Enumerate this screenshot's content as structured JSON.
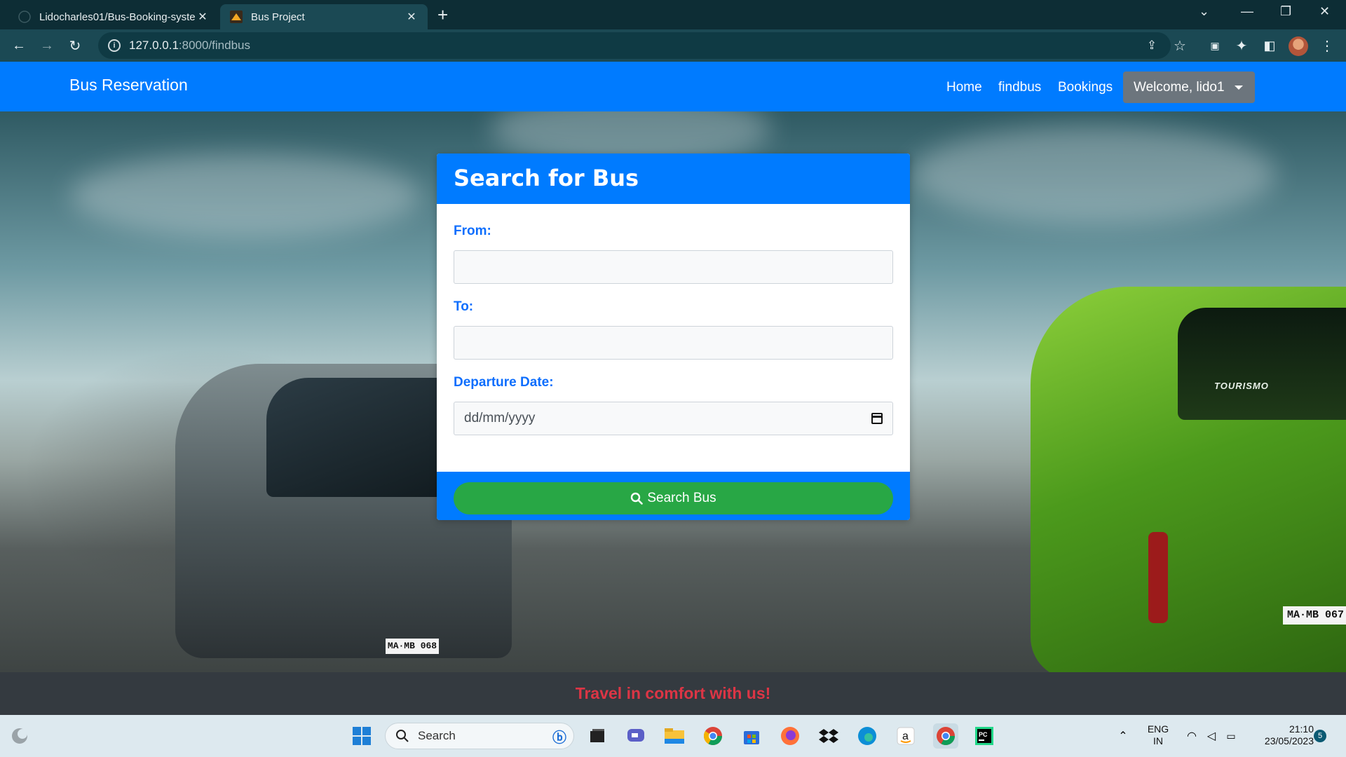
{
  "browser": {
    "tabs": [
      {
        "title": "Lidocharles01/Bus-Booking-syste",
        "active": false
      },
      {
        "title": "Bus Project",
        "active": true
      }
    ],
    "url_host": "127.0.0.1",
    "url_path": ":8000/findbus"
  },
  "navbar": {
    "brand": "Bus Reservation",
    "links": [
      "Home",
      "findbus",
      "Bookings"
    ],
    "user_menu": "Welcome, lido1"
  },
  "search_card": {
    "title": "Search for Bus",
    "from_label": "From:",
    "from_value": "",
    "to_label": "To:",
    "to_value": "",
    "date_label": "Departure Date:",
    "date_placeholder": "dd/mm/yyyy",
    "submit_label": "Search Bus"
  },
  "hero": {
    "bus_left_plate": "MA·MB 068",
    "bus_right_brand": "TOURISMO",
    "bus_right_plate": "MA·MB 067"
  },
  "footer": {
    "tagline": "Travel in comfort with us!"
  },
  "taskbar": {
    "search_placeholder": "Search",
    "lang_top": "ENG",
    "lang_bottom": "IN",
    "time": "21:10",
    "date": "23/05/2023",
    "notifications": "5"
  },
  "colors": {
    "primary": "#007bff",
    "success": "#28a745",
    "danger": "#dc3545",
    "secondary": "#6c757d",
    "dark": "#343a40"
  }
}
